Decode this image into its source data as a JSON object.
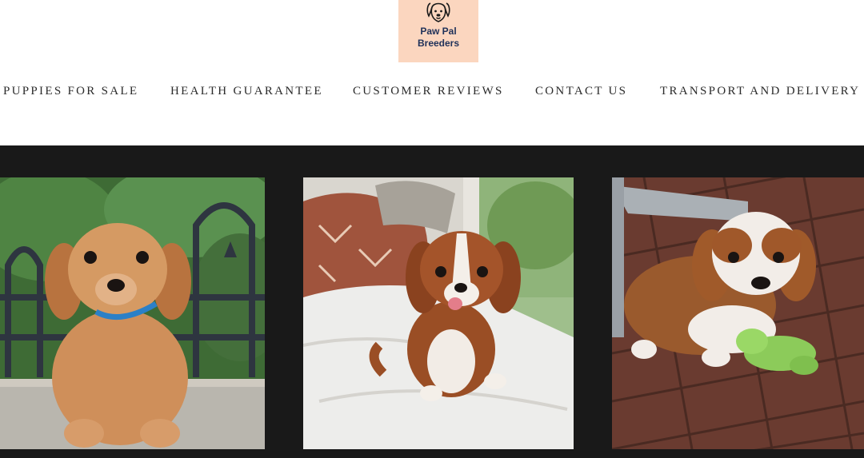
{
  "header": {
    "logo": {
      "line1": "Paw Pal",
      "line2": "Breeders",
      "icon": "puppy-face-icon",
      "background_color": "#fbd6bf",
      "text_color": "#20325a"
    }
  },
  "nav": {
    "items": [
      {
        "label": "PUPPIES FOR SALE"
      },
      {
        "label": "HEALTH GUARANTEE"
      },
      {
        "label": "CUSTOMER REVIEWS"
      },
      {
        "label": "CONTACT US"
      },
      {
        "label": "TRANSPORT AND DELIVERY"
      }
    ]
  },
  "gallery": {
    "background_color": "#191919",
    "photos": [
      {
        "subject": "ruby cavalier puppy with blue collar on stone ledge in front of iron fence"
      },
      {
        "subject": "blenheim cavalier puppy licking nose on white cushion"
      },
      {
        "subject": "blenheim cavalier puppy with green plush toy on brick patio"
      }
    ]
  }
}
